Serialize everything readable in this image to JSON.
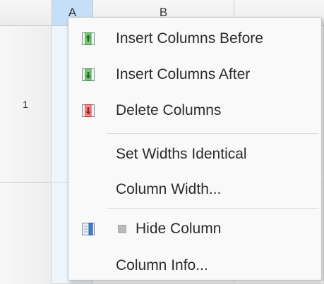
{
  "sheet": {
    "col_headers": [
      "A",
      "B"
    ],
    "row_headers": [
      "1"
    ],
    "selected_column": "A"
  },
  "context_menu": {
    "items": [
      {
        "label": "Insert Columns Before",
        "icon": "insert-columns-before-icon"
      },
      {
        "label": "Insert Columns After",
        "icon": "insert-columns-after-icon"
      },
      {
        "label": "Delete Columns",
        "icon": "delete-columns-icon"
      },
      {
        "label": "Set Widths Identical",
        "icon": ""
      },
      {
        "label": "Column Width...",
        "icon": ""
      },
      {
        "label": "Hide Column",
        "icon": "hide-column-icon",
        "checked": false
      },
      {
        "label": "Column Info...",
        "icon": ""
      }
    ]
  },
  "colors": {
    "selected_header": "#c5dff8",
    "menu_background": "#f9f9f9",
    "icon_green": "#3c9a3c",
    "icon_red": "#d23c3c",
    "icon_blue": "#3f7fc7"
  }
}
